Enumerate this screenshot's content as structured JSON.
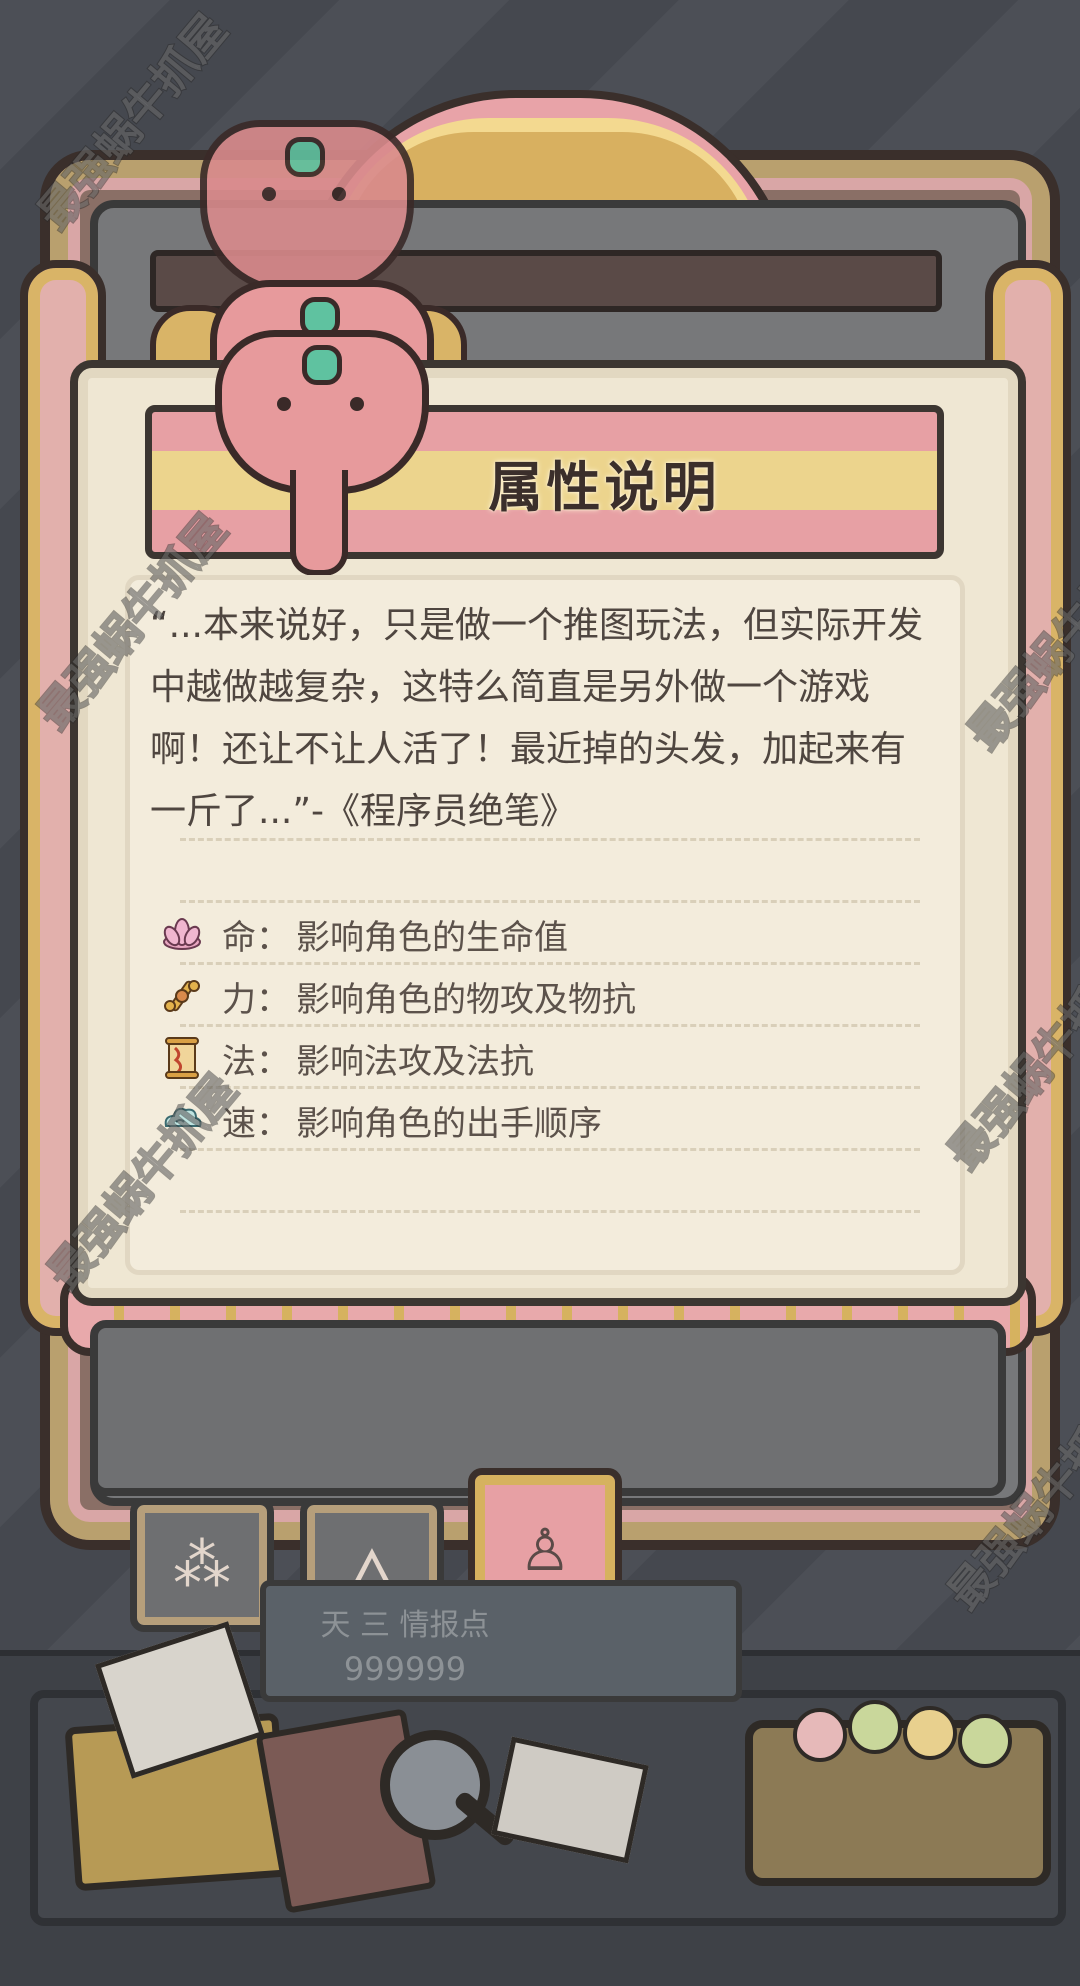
{
  "dialog": {
    "title": "属性说明",
    "quote": "“...本来说好，只是做一个推图玩法，但实际开发中越做越复杂，这特么简直是另外做一个游戏啊！还让不让人活了！最近掉的头发，加起来有一斤了...”-《程序员绝笔》"
  },
  "attributes": [
    {
      "icon": "lotus-icon",
      "key": "命：",
      "desc": "影响角色的生命值"
    },
    {
      "icon": "vajra-icon",
      "key": "力：",
      "desc": "影响角色的物攻及物抗"
    },
    {
      "icon": "scroll-icon",
      "key": "法：",
      "desc": "影响法攻及法抗"
    },
    {
      "icon": "cloud-icon",
      "key": "速：",
      "desc": "影响角色的出手顺序"
    }
  ],
  "background": {
    "tabs": [
      {
        "icon": "prayer-beads-icon",
        "glyph": "⁂"
      },
      {
        "icon": "flame-icon",
        "glyph": "🜂"
      },
      {
        "icon": "monk-icon",
        "glyph": "♙"
      }
    ],
    "points_label": "天 三 情报点",
    "points_value": "999999"
  },
  "watermark": "最强蜗牛抓屋",
  "colors": {
    "panel": "#efe7d3",
    "banner_pink": "#e7a0a4",
    "banner_gold": "#ecd48d",
    "text": "#4f4640"
  }
}
